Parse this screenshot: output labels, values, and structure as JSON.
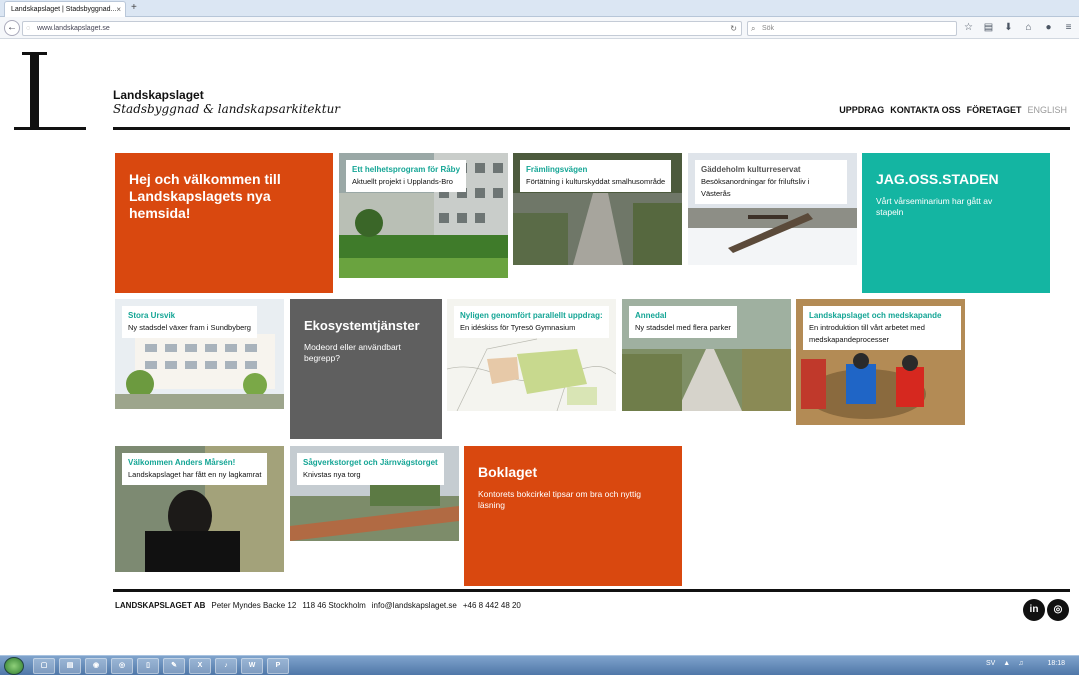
{
  "browser": {
    "tab_title": "Landskapslaget | Stadsbyggnad...",
    "tab_close": "×",
    "new_tab": "+",
    "url": "www.landskapslaget.se",
    "search_placeholder": "Sök"
  },
  "site": {
    "name": "Landskapslaget",
    "tagline": "Stadsbyggnad & landskapsarkitektur"
  },
  "nav": [
    "UPPDRAG",
    "KONTAKTA OSS",
    "FÖRETAGET",
    "ENGLISH"
  ],
  "tiles": {
    "welcome": {
      "title": "Hej och välkommen till Landskapslagets nya hemsida!"
    },
    "raby": {
      "title": "Ett helhetsprogram för Råby",
      "body": "Aktuellt projekt i Upplands-Bro"
    },
    "framlingsvagen": {
      "title": "Främlingsvägen",
      "body": "Förtätning i kulturskyddat smalhusområde"
    },
    "gaddeholm": {
      "title": "Gäddeholm kulturreservat",
      "body": "Besöksanordningar för friluftsliv i Västerås"
    },
    "jagoss": {
      "title": "JAG.OSS.STADEN",
      "body": "Vårt vårseminarium har gått av stapeln"
    },
    "ursvik": {
      "title": "Stora Ursvik",
      "body": "Ny stadsdel växer fram i Sundbyberg"
    },
    "ekosystem": {
      "title": "Ekosystemtjänster",
      "body": "Modeord eller användbart begrepp?"
    },
    "tyreso": {
      "title": "Nyligen genomfört parallellt uppdrag:",
      "body": "En idéskiss för Tyresö Gymnasium"
    },
    "annedal": {
      "title": "Annedal",
      "body": "Ny stadsdel med flera parker"
    },
    "medskapande": {
      "title": "Landskapslaget och medskapande",
      "body": "En introduktion till vårt arbetet med medskapandeprocesser"
    },
    "marsen": {
      "title": "Välkommen Anders Mårsén!",
      "body": "Landskapslaget har fått en ny lagkamrat"
    },
    "sagverk": {
      "title": "Sågverkstorget och Järnvägstorget",
      "body": "Knivstas nya torg"
    },
    "boklaget": {
      "title": "Boklaget",
      "body": "Kontorets bokcirkel tipsar om bra och nyttig läsning"
    }
  },
  "footer": {
    "company": "LANDSKAPSLAGET AB",
    "address": "Peter Myndes Backe 12",
    "city": "118 46 Stockholm",
    "email": "info@landskapslaget.se",
    "phone": "+46 8 442 48 20",
    "linkedin": "in",
    "instagram": "◎"
  },
  "taskbar": {
    "lang": "SV",
    "time": "18:18"
  },
  "colors": {
    "orange": "#d9480f",
    "teal": "#14b5a2",
    "grey": "#5f5f5f"
  }
}
